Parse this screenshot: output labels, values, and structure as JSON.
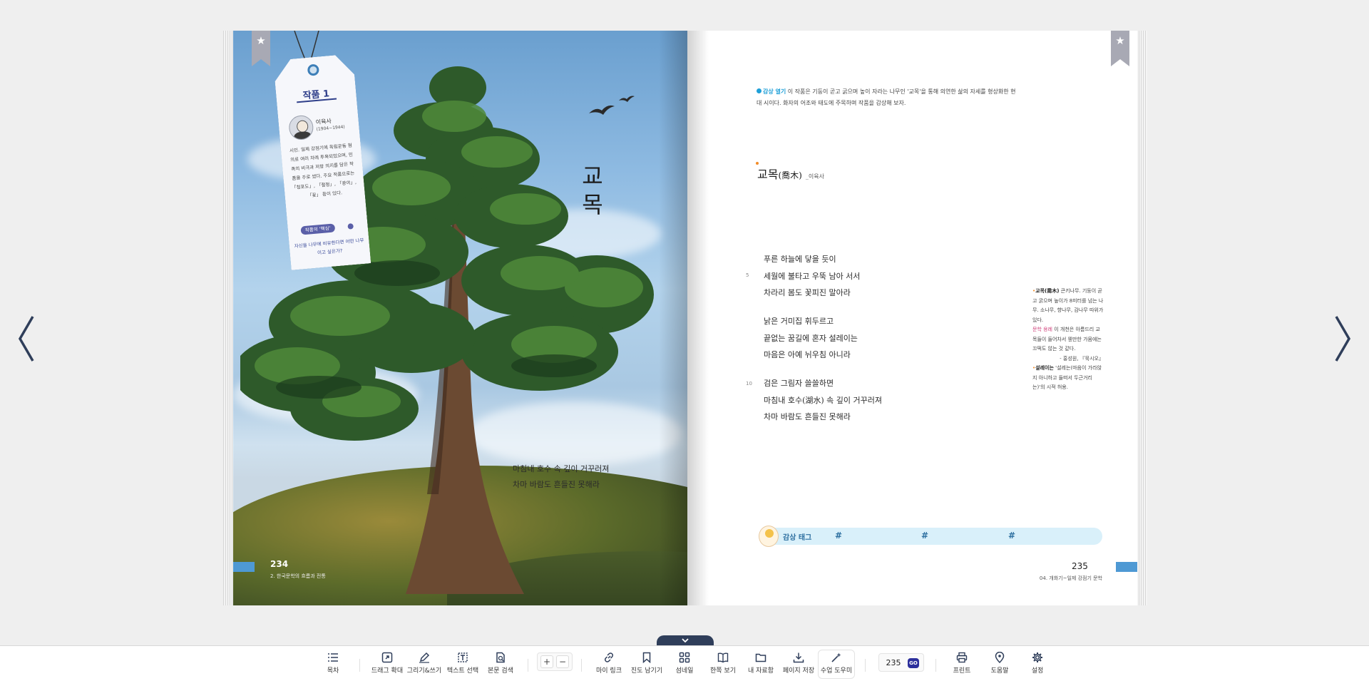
{
  "book": {
    "left_page": {
      "number": "234",
      "chapter": "2. 한국문학의 흐름과 전통",
      "vertical_title": "교 목",
      "excerpt_lines": [
        "마침내 호수 속 깊이 거꾸러져",
        "차마 바람도 흔들진 못해라"
      ],
      "tag": {
        "title": "작품 1",
        "author": "이육사",
        "years": "(1904~1944)",
        "bio": "시인. 일제 강점기에 독립운동 혐의로 여러 차례 투옥되었으며, 민족의 비극과 저항 의지를 담은 작품을 주로 썼다. 주요 작품으로는 「청포도」, 「절정」, 「광야」, 「꽃」 등이 있다.",
        "key_label": "작품의 '핵심'",
        "question": "자신을 나무에 비유한다면 어떤 나무이고 싶은가?"
      }
    },
    "right_page": {
      "number": "235",
      "chapter": "04. 개화기~일제 강점기 문학",
      "intro_badge": "감상 열기",
      "intro_text": "이 작품은 기둥이 곧고 굵으며 높이 자라는 나무인 '교목'을 통해 의연한 삶의 자세를 형상화한 현대 시이다. 화자의 어조와 태도에 주목하며 작품을 감상해 보자.",
      "poem_title": "교목",
      "poem_title_hanja": "(喬木)",
      "poem_byline": "_이육사",
      "line_numbers": [
        "5",
        "10"
      ],
      "stanzas": [
        [
          "푸른 하늘에 닿을 듯이",
          "세월에 불타고 우뚝 남아 서서",
          "차라리 봄도 꽃피진 말아라"
        ],
        [
          "낡은 거미집 휘두르고",
          "끝없는 꿈길에 혼자 설레이는",
          "마음은 아예 뉘우침 아니라"
        ],
        [
          "검은 그림자 쓸쓸하면",
          "마침내 호수(湖水) 속 깊이 거꾸러져",
          "차마 바람도 흔들진 못해라"
        ]
      ],
      "notes": {
        "n1_term": "교목(喬木)",
        "n1_text": "큰키나무. 기둥이 곧고 굵으며 높이가 8미터를 넘는 나무. 소나무, 향나무, 감나무 따위가 있다.",
        "n2_term": "문학 용례",
        "n2_text": "이 개천은 아름드리 교목들이 들어차서 웬만한 가뭄에는 끄떡도 않는 것 같다.",
        "n2_source": "- 홍성원, 『묵시오』",
        "n3_term": "설레이는",
        "n3_text": "'설레는(마음이 가라앉지 아니하고 들떠서 두근거리는)'의 시적 허용."
      },
      "tagbar_label": "감상 태그",
      "hashes": [
        "#",
        "#",
        "#"
      ]
    }
  },
  "toolbar": {
    "toc": "목차",
    "drag_zoom": "드래그 확대",
    "draw_write": "그리기&쓰기",
    "text_select": "텍스트 선택",
    "body_search": "본문 검색",
    "zoom_in": "+",
    "zoom_out": "−",
    "my_link": "마이 링크",
    "save_progress": "진도 남기기",
    "thumbnail": "섬네일",
    "single_view": "한쪽 보기",
    "my_materials": "내 자료함",
    "save_page": "페이지 저장",
    "class_helper": "수업 도우미",
    "page_value": "235",
    "go": "GO",
    "print": "프린트",
    "help": "도움말",
    "settings": "설정"
  },
  "colors": {
    "accent": "#4e99d4",
    "toolbar_go": "#2c2f9c",
    "nav_arrow": "#2f3e5a"
  }
}
